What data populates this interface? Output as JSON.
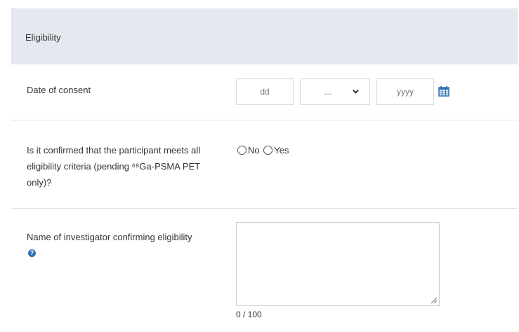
{
  "section": {
    "title": "Eligibility"
  },
  "consent": {
    "label": "Date of consent",
    "day_placeholder": "dd",
    "month_value": "...",
    "year_placeholder": "yyyy"
  },
  "criteria": {
    "label_line1": "Is it confirmed that the participant meets all",
    "label_line2": "eligibility criteria (pending ⁶⁸Ga-PSMA PET",
    "label_line3": "only)?",
    "option_no": "No",
    "option_yes": "Yes"
  },
  "investigator": {
    "label": "Name of investigator confirming eligibility",
    "help_symbol": "?",
    "value": "",
    "counter": "0 / 100"
  },
  "colors": {
    "header_bg": "#e4e8ef",
    "accent": "#2f6fb5",
    "border": "#d8d8d8"
  }
}
